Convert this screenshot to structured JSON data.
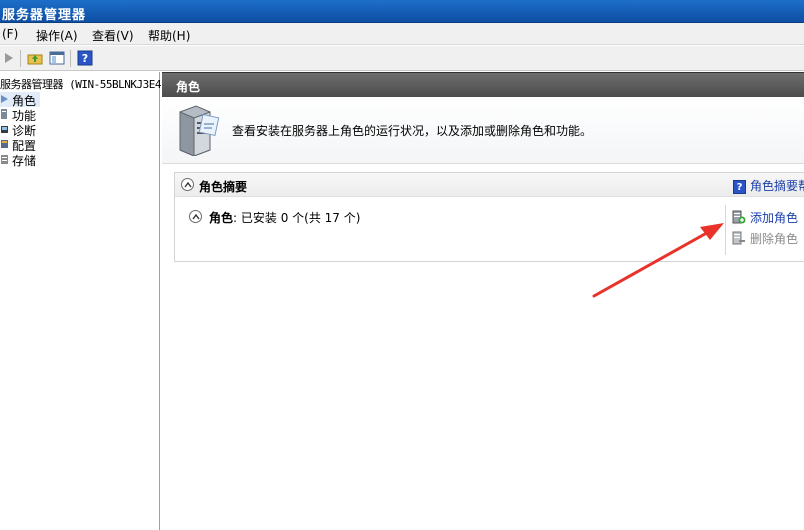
{
  "window": {
    "title": "服务器管理器"
  },
  "menu": [
    {
      "label": "(F)"
    },
    {
      "label": "操作(A)"
    },
    {
      "label": "查看(V)"
    },
    {
      "label": "帮助(H)"
    }
  ],
  "tree": {
    "root": "服务器管理器 (WIN-55BLNKJ3E4",
    "items": [
      {
        "label": "角色",
        "icon": "roles-icon",
        "selected": true
      },
      {
        "label": "功能",
        "icon": "features-icon"
      },
      {
        "label": "诊断",
        "icon": "diagnostics-icon"
      },
      {
        "label": "配置",
        "icon": "configuration-icon"
      },
      {
        "label": "存储",
        "icon": "storage-icon"
      }
    ]
  },
  "rightpane": {
    "header": "角色",
    "banner_text": "查看安装在服务器上角色的运行状况，以及添加或删除角色和功能。",
    "summary": {
      "title": "角色摘要",
      "help_link": "角色摘要帮",
      "roles_label": "角色",
      "roles_value": ": 已安装 0 个(共 17 个)",
      "actions": [
        {
          "label": "添加角色",
          "enabled": true
        },
        {
          "label": "删除角色",
          "enabled": false
        }
      ]
    }
  },
  "colors": {
    "titlebar": "#1d6fc9",
    "header_dark": "#5a5a5a",
    "link": "#1a3ea8",
    "annotation_arrow": "#e8322a"
  }
}
